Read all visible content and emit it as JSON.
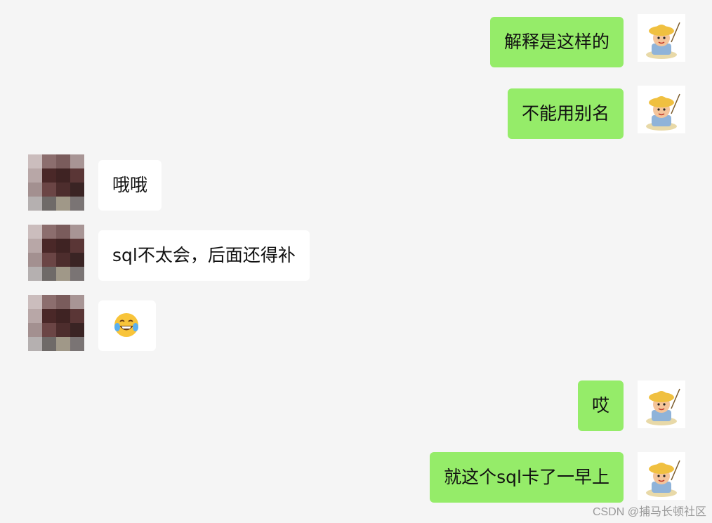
{
  "messages": [
    {
      "side": "out",
      "text": "解释是这样的"
    },
    {
      "side": "out",
      "text": "不能用别名"
    },
    {
      "side": "in",
      "text": "哦哦"
    },
    {
      "side": "in",
      "text": "sql不太会，后面还得补"
    },
    {
      "side": "in",
      "emoji": "laughing-with-tears"
    },
    {
      "side": "out",
      "text": "哎"
    },
    {
      "side": "out",
      "text": "就这个sql卡了一早上"
    }
  ],
  "watermark": "CSDN @捕马长顿社区",
  "colors": {
    "background": "#f5f5f5",
    "outgoing_bubble": "#95ec69",
    "incoming_bubble": "#ffffff",
    "text": "#111111"
  },
  "icons": {
    "my_avatar": "cartoon-fisherman-avatar",
    "contact_avatar": "pixelated-avatar",
    "emoji": "laughing-crying-emoji"
  }
}
